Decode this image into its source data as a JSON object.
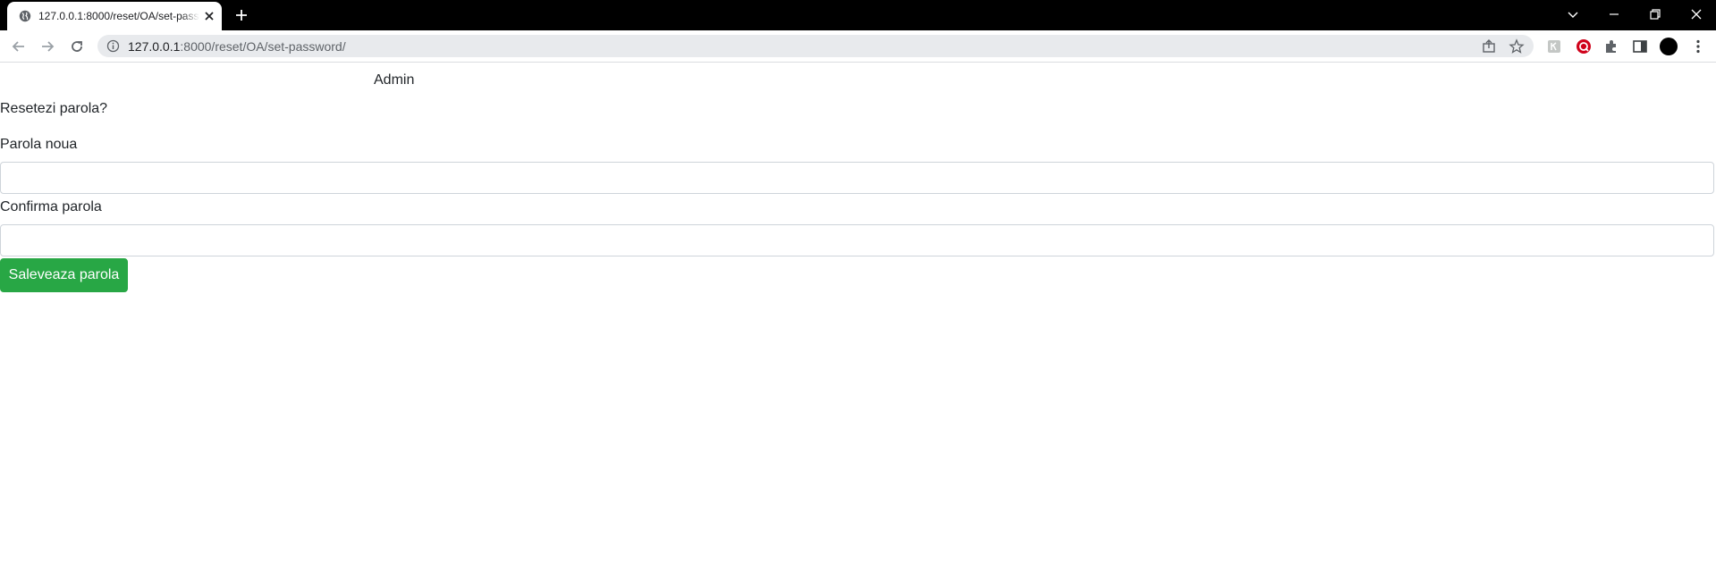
{
  "browser": {
    "tab": {
      "title": "127.0.0.1:8000/reset/OA/set-password/",
      "favicon": "globe-icon"
    },
    "address": {
      "host": "127.0.0.1",
      "path": ":8000/reset/OA/set-password/"
    },
    "window_controls": [
      "chevron-down-icon",
      "minimize-icon",
      "restore-icon",
      "close-icon"
    ],
    "toolbar_icons": [
      "back-arrow-icon",
      "forward-arrow-icon",
      "reload-icon",
      "info-icon",
      "share-icon",
      "star-icon",
      "extension-icon",
      "extension-red-icon",
      "puzzle-icon",
      "side-panel-icon",
      "profile-avatar",
      "kebab-menu-icon"
    ]
  },
  "page": {
    "nav": {
      "admin": "Admin"
    },
    "title": "Resetezi parola?",
    "fields": {
      "new_password_label": "Parola noua",
      "confirm_password_label": "Confirma parola"
    },
    "save_button": "Saleveaza parola"
  },
  "colors": {
    "button_green": "#28a745",
    "tabstrip": "#000000",
    "omnibox": "#e8eaed"
  }
}
